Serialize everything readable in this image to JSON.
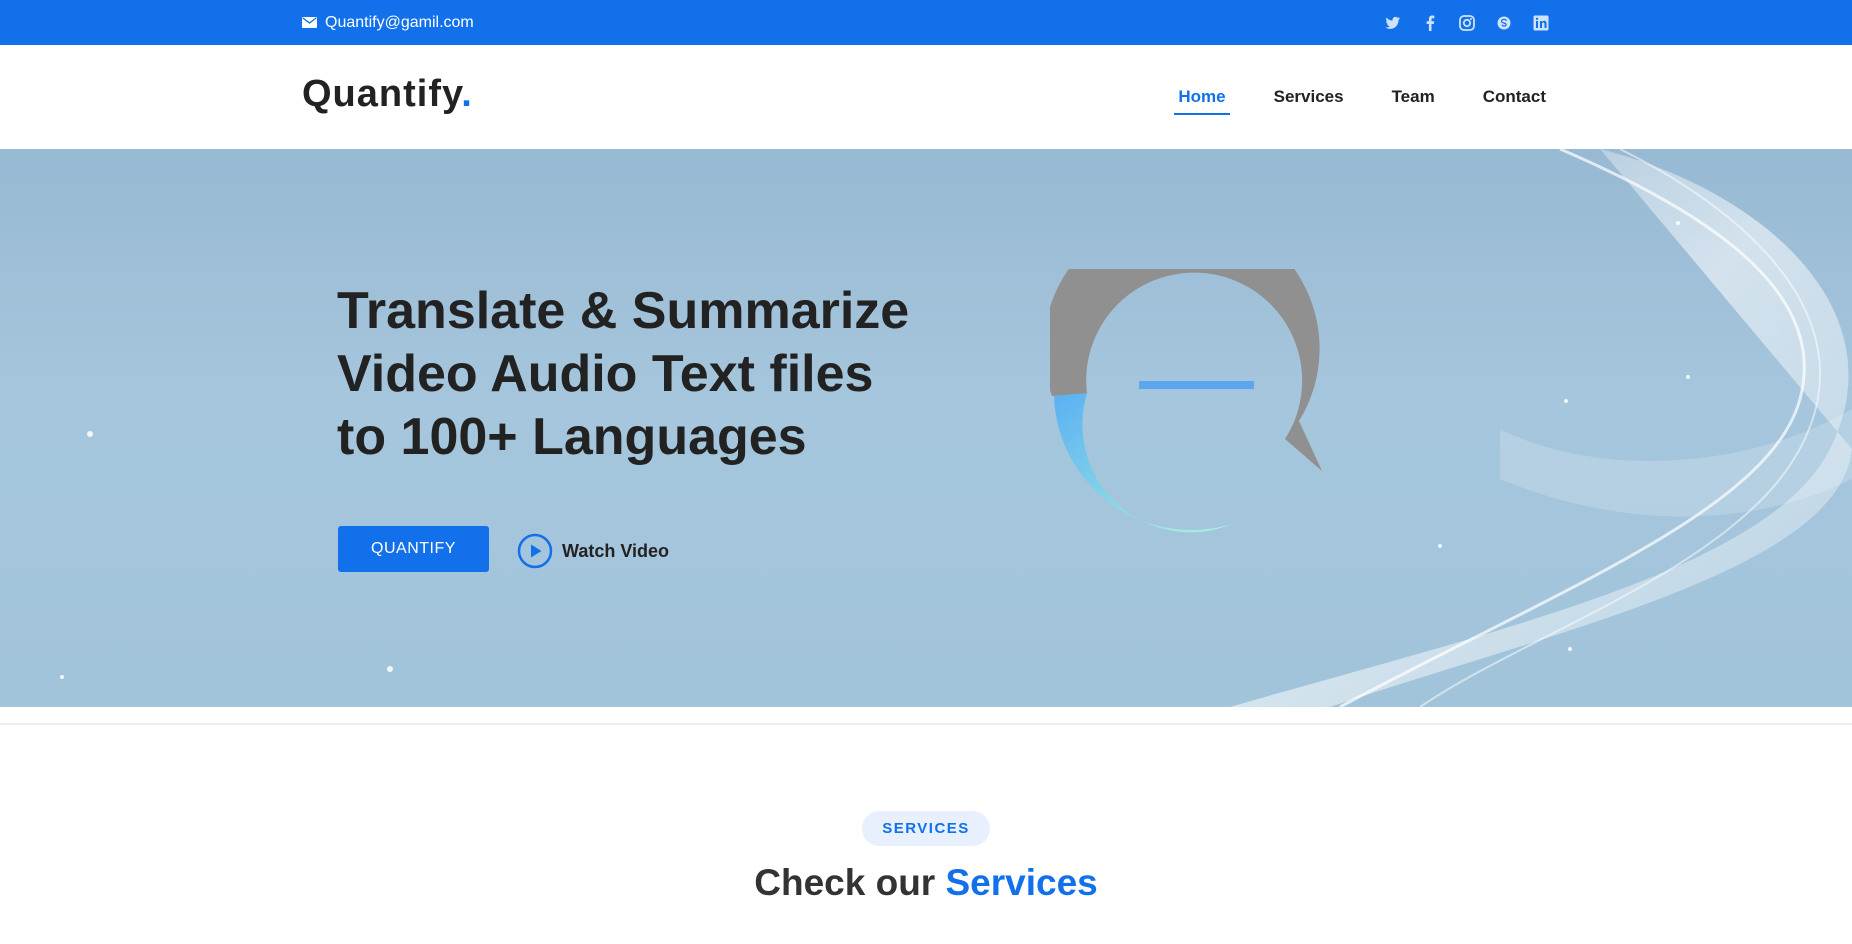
{
  "topbar": {
    "email": "Quantify@gamil.com",
    "email_icon": "envelope-icon",
    "socials": [
      {
        "name": "twitter-icon"
      },
      {
        "name": "facebook-icon"
      },
      {
        "name": "instagram-icon"
      },
      {
        "name": "skype-icon"
      },
      {
        "name": "linkedin-icon"
      }
    ]
  },
  "header": {
    "logo_text": "Quantify",
    "logo_dot": ".",
    "nav": [
      {
        "label": "Home",
        "active": true
      },
      {
        "label": "Services",
        "active": false
      },
      {
        "label": "Team",
        "active": false
      },
      {
        "label": "Contact",
        "active": false
      }
    ]
  },
  "hero": {
    "title_lines": [
      "Translate & Summarize",
      "Video Audio Text files",
      "to 100+ Languages"
    ],
    "cta_label": "QUANTIFY",
    "watch_label": "Watch Video",
    "play_icon": "play-circle-icon"
  },
  "services": {
    "badge": "SERVICES",
    "title_prefix": "Check our",
    "title_accent": "Services"
  },
  "colors": {
    "brand": "#1170ea",
    "text": "#222222",
    "hero_bg": "#a2c4da",
    "badge_bg": "#e7f0fc"
  }
}
